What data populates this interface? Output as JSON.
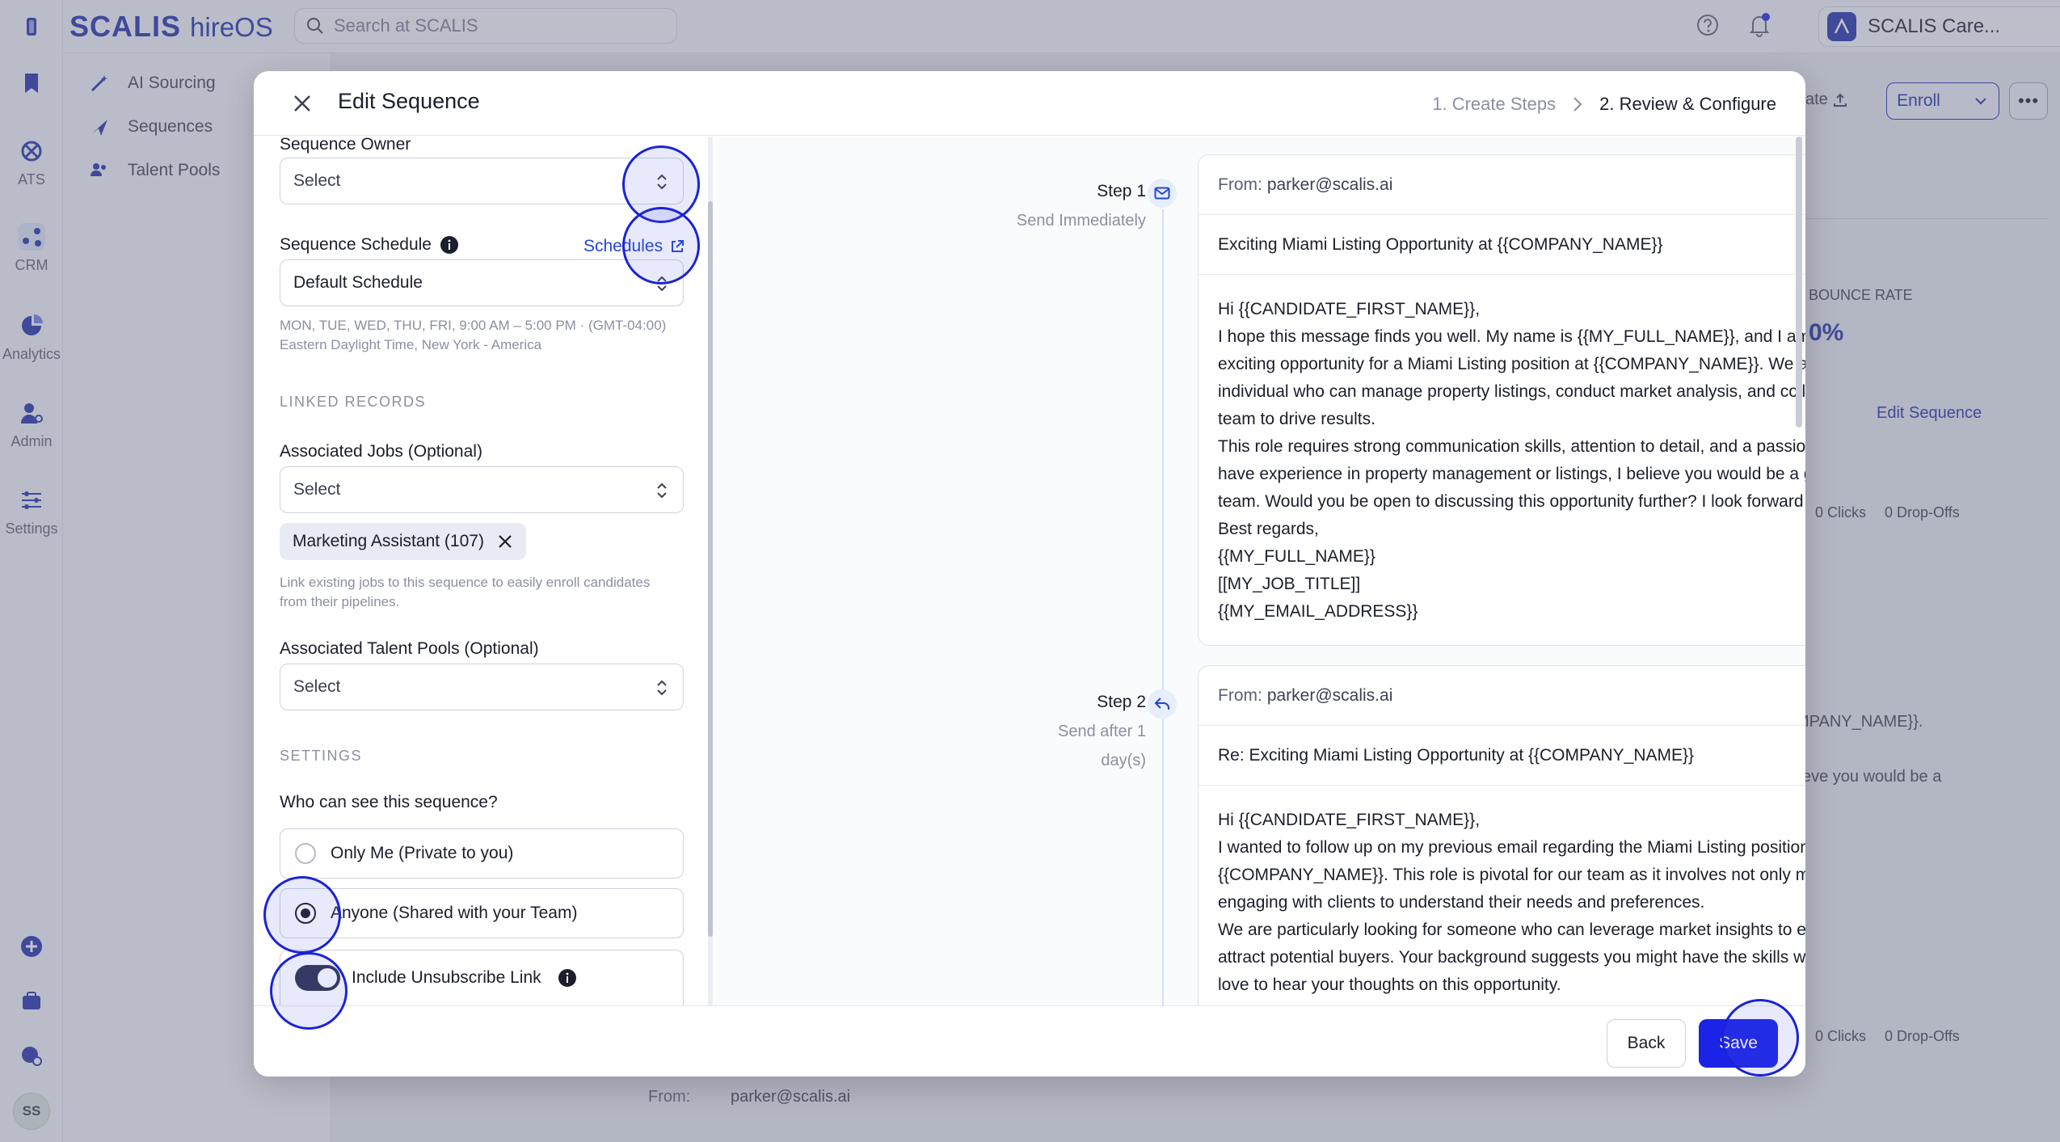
{
  "app": {
    "brand_main": "SCALIS",
    "brand_sub": "hireOS",
    "search_placeholder": "Search at SCALIS",
    "org_name": "SCALIS Care...",
    "user_initials": "SS"
  },
  "rail": {
    "items": [
      {
        "label": "",
        "icon": "bookmark-icon"
      },
      {
        "label": "ATS",
        "icon": "ats-icon"
      },
      {
        "label": "CRM",
        "icon": "crm-icon"
      },
      {
        "label": "Analytics",
        "icon": "analytics-icon"
      },
      {
        "label": "Admin",
        "icon": "admin-icon"
      },
      {
        "label": "Settings",
        "icon": "settings-icon"
      }
    ]
  },
  "subnav": {
    "items": [
      {
        "label": "AI Sourcing",
        "icon": "wand-icon"
      },
      {
        "label": "Sequences",
        "icon": "send-icon"
      },
      {
        "label": "Talent Pools",
        "icon": "people-icon"
      }
    ]
  },
  "background": {
    "enroll_label": "Enroll",
    "update_label": "ate",
    "bounce_rate_label": "BOUNCE RATE",
    "bounce_rate_value": "0%",
    "edit_sequence_link": "Edit Sequence",
    "clicks_1": "0 Clicks",
    "dropoffs_1": "0 Drop-Offs",
    "clicks_2": "0 Clicks",
    "dropoffs_2": "0 Drop-Offs",
    "snippet_1": "MPANY_NAME}}.",
    "snippet_2": "eve you would be a",
    "from_label": "From:",
    "from_value": "parker@scalis.ai"
  },
  "modal": {
    "title": "Edit Sequence",
    "steps": [
      "1. Create Steps",
      "2. Review & Configure"
    ],
    "sequence_owner": {
      "label": "Sequence Owner",
      "value": "Select"
    },
    "sequence_schedule": {
      "label": "Sequence Schedule",
      "link": "Schedules",
      "value": "Default Schedule",
      "hint": "MON, TUE, WED, THU, FRI, 9:00 AM – 5:00 PM · (GMT-04:00) Eastern Daylight Time, New York - America"
    },
    "linked_records_heading": "LINKED RECORDS",
    "associated_jobs": {
      "label": "Associated Jobs (Optional)",
      "value": "Select",
      "chip": "Marketing Assistant (107)",
      "hint": "Link existing jobs to this sequence to easily enroll candidates from their pipelines."
    },
    "associated_pools": {
      "label": "Associated Talent Pools (Optional)",
      "value": "Select"
    },
    "settings_heading": "SETTINGS",
    "visibility": {
      "question": "Who can see this sequence?",
      "options": [
        "Only Me (Private to you)",
        "Anyone (Shared with your Team)"
      ],
      "selected": 1
    },
    "unsubscribe": {
      "label": "Include Unsubscribe Link",
      "enabled": true
    },
    "sequence_steps": [
      {
        "title": "Step 1",
        "timing": "Send Immediately",
        "from_label": "From:",
        "from": "parker@scalis.ai",
        "subject": "Exciting Miami Listing Opportunity at {{COMPANY_NAME}}",
        "body": [
          "Hi {{CANDIDATE_FIRST_NAME}},",
          "I hope this message finds you well. My name is {{MY_FULL_NAME}}, and I am reaching out to share an exciting opportunity for a Miami Listing position at {{COMPANY_NAME}}. We are looking for a talented individual who can manage property listings, conduct market analysis, and collaborate with our sales team to drive results.",
          "This role requires strong communication skills, attention to detail, and a passion for real estate. If you have experience in property management or listings, I believe you would be a great fit for our growing team. Would you be open to discussing this opportunity further? I look forward to hearing from you!",
          "Best regards,",
          "{{MY_FULL_NAME}}",
          "[[MY_JOB_TITLE]]",
          "{{MY_EMAIL_ADDRESS}}"
        ]
      },
      {
        "title": "Step 2",
        "timing": "Send after 1 day(s)",
        "from_label": "From:",
        "from": "parker@scalis.ai",
        "subject": "Re: Exciting Miami Listing Opportunity at {{COMPANY_NAME}}",
        "body": [
          "Hi {{CANDIDATE_FIRST_NAME}},",
          "I wanted to follow up on my previous email regarding the Miami Listing position at {{COMPANY_NAME}}. This role is pivotal for our team as it involves not only managing listings but also engaging with clients to understand their needs and preferences.",
          "We are particularly looking for someone who can leverage market insights to enhance our listings and attract potential buyers. Your background suggests you might have the skills we are looking for. I would love to hear your thoughts on this opportunity."
        ]
      }
    ],
    "back_label": "Back",
    "save_label": "Save"
  },
  "colors": {
    "accent": "#1a23e6",
    "brand": "#1f2fa8",
    "highlight_ring": "#1a23d6"
  }
}
